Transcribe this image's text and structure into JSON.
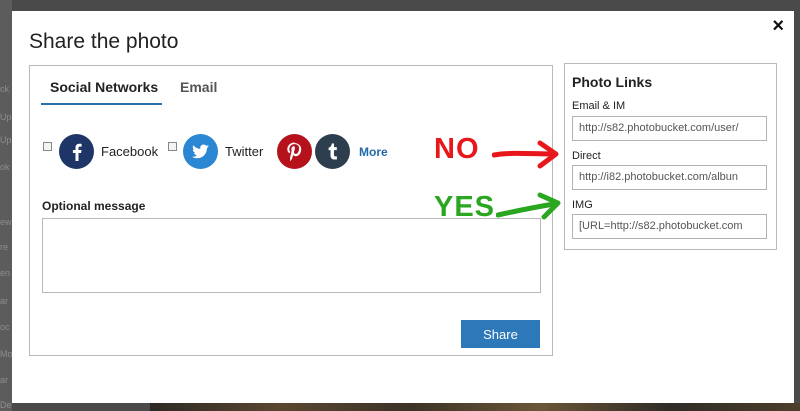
{
  "modal": {
    "title": "Share the photo",
    "close_label": "×"
  },
  "tabs": [
    {
      "label": "Social Networks",
      "active": true
    },
    {
      "label": "Email",
      "active": false
    }
  ],
  "networks": {
    "facebook_label": "Facebook",
    "twitter_label": "Twitter",
    "more_label": "More",
    "facebook_color": "#1e3667",
    "twitter_color": "#2b87d3",
    "pinterest_color": "#b5121b",
    "tumblr_color": "#2d3e4f"
  },
  "message": {
    "label": "Optional message",
    "value": ""
  },
  "share_button": {
    "label": "Share"
  },
  "photo_links": {
    "title": "Photo Links",
    "email_im_label": "Email & IM",
    "email_im_value": "http://s82.photobucket.com/user/",
    "direct_label": "Direct",
    "direct_value": "http://i82.photobucket.com/albun",
    "img_label": "IMG",
    "img_value": "[URL=http://s82.photobucket.com"
  },
  "annotations": {
    "no_text": "NO",
    "yes_text": "YES",
    "no_color": "#e8171b",
    "yes_color": "#2aa620"
  },
  "background_page": {
    "fragments": [
      "ck",
      "Up",
      "Up",
      "ok",
      "ew",
      "re",
      "en",
      "ar",
      "oc",
      "Mo",
      "ar",
      "De"
    ]
  }
}
